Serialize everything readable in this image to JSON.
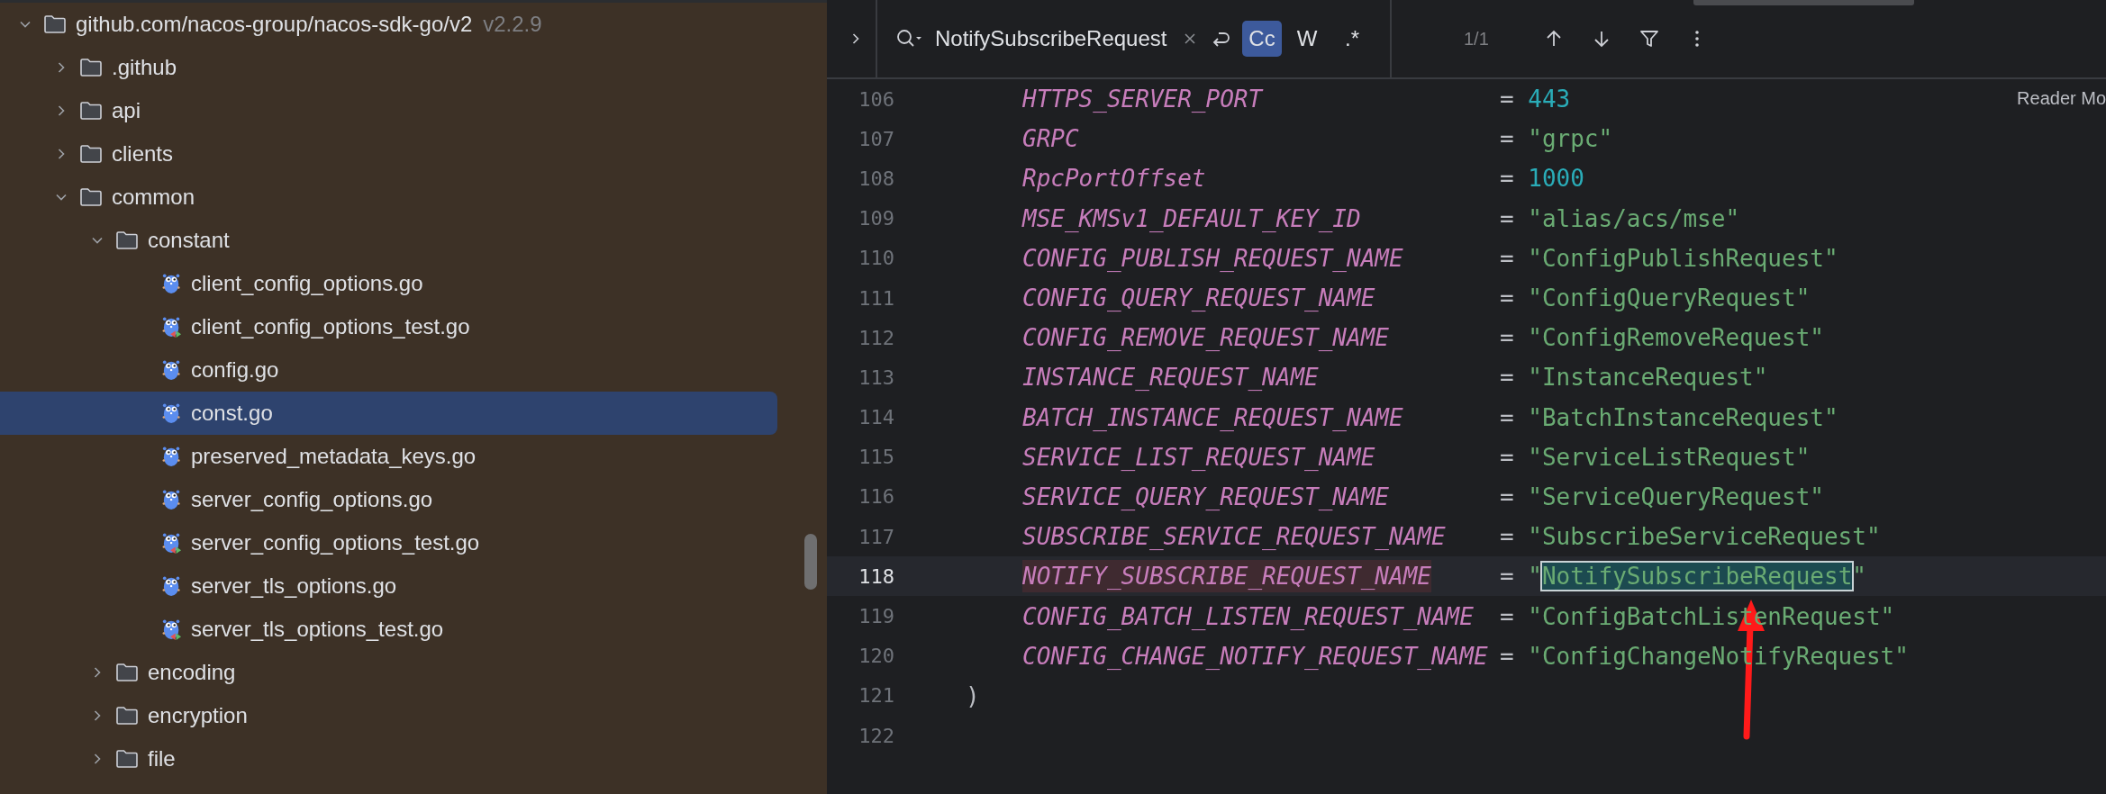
{
  "project_tree": {
    "items": [
      {
        "name": "github.com/nacos-group/nacos-sdk-go/v2",
        "version": "v2.2.9",
        "kind": "folder",
        "expanded": true,
        "selected": false,
        "children": [
          {
            "name": ".github",
            "kind": "folder",
            "expanded": false,
            "selected": false
          },
          {
            "name": "api",
            "kind": "folder",
            "expanded": false,
            "selected": false
          },
          {
            "name": "clients",
            "kind": "folder",
            "expanded": false,
            "selected": false
          },
          {
            "name": "common",
            "kind": "folder",
            "expanded": true,
            "selected": false,
            "children": [
              {
                "name": "constant",
                "kind": "folder",
                "expanded": true,
                "selected": false,
                "children": [
                  {
                    "name": "client_config_options.go",
                    "kind": "file",
                    "selected": false
                  },
                  {
                    "name": "client_config_options_test.go",
                    "kind": "test",
                    "selected": false
                  },
                  {
                    "name": "config.go",
                    "kind": "file",
                    "selected": false
                  },
                  {
                    "name": "const.go",
                    "kind": "file",
                    "selected": true
                  },
                  {
                    "name": "preserved_metadata_keys.go",
                    "kind": "file",
                    "selected": false
                  },
                  {
                    "name": "server_config_options.go",
                    "kind": "file",
                    "selected": false
                  },
                  {
                    "name": "server_config_options_test.go",
                    "kind": "test",
                    "selected": false
                  },
                  {
                    "name": "server_tls_options.go",
                    "kind": "file",
                    "selected": false
                  },
                  {
                    "name": "server_tls_options_test.go",
                    "kind": "test",
                    "selected": false
                  }
                ]
              },
              {
                "name": "encoding",
                "kind": "folder",
                "expanded": false,
                "selected": false
              },
              {
                "name": "encryption",
                "kind": "folder",
                "expanded": false,
                "selected": false
              },
              {
                "name": "file",
                "kind": "folder",
                "expanded": false,
                "selected": false
              }
            ]
          }
        ]
      }
    ]
  },
  "search_bar": {
    "query": "NotifySubscribeRequest",
    "options": [
      {
        "label": "Cc",
        "selected": true
      },
      {
        "label": "W",
        "selected": false
      },
      {
        "label": ".*",
        "selected": false
      }
    ],
    "result_count": "1/1"
  },
  "reader_mode": "Reader Mo",
  "code_lines": [
    {
      "number": "106",
      "kind": "number",
      "name": "HTTPS_SERVER_PORT",
      "equals": "=",
      "value": "443",
      "current": false,
      "match": false
    },
    {
      "number": "107",
      "kind": "string",
      "name": "GRPC",
      "equals": "=",
      "value": "\"grpc\"",
      "current": false,
      "match": false
    },
    {
      "number": "108",
      "kind": "number",
      "name": "RpcPortOffset",
      "equals": "=",
      "value": "1000",
      "current": false,
      "match": false
    },
    {
      "number": "109",
      "kind": "string",
      "name": "MSE_KMSv1_DEFAULT_KEY_ID",
      "equals": "=",
      "value": "\"alias/acs/mse\"",
      "current": false,
      "match": false
    },
    {
      "number": "110",
      "kind": "string",
      "name": "CONFIG_PUBLISH_REQUEST_NAME",
      "equals": "=",
      "value": "\"ConfigPublishRequest\"",
      "current": false,
      "match": false
    },
    {
      "number": "111",
      "kind": "string",
      "name": "CONFIG_QUERY_REQUEST_NAME",
      "equals": "=",
      "value": "\"ConfigQueryRequest\"",
      "current": false,
      "match": false
    },
    {
      "number": "112",
      "kind": "string",
      "name": "CONFIG_REMOVE_REQUEST_NAME",
      "equals": "=",
      "value": "\"ConfigRemoveRequest\"",
      "current": false,
      "match": false
    },
    {
      "number": "113",
      "kind": "string",
      "name": "INSTANCE_REQUEST_NAME",
      "equals": "=",
      "value": "\"InstanceRequest\"",
      "current": false,
      "match": false
    },
    {
      "number": "114",
      "kind": "string",
      "name": "BATCH_INSTANCE_REQUEST_NAME",
      "equals": "=",
      "value": "\"BatchInstanceRequest\"",
      "current": false,
      "match": false
    },
    {
      "number": "115",
      "kind": "string",
      "name": "SERVICE_LIST_REQUEST_NAME",
      "equals": "=",
      "value": "\"ServiceListRequest\"",
      "current": false,
      "match": false
    },
    {
      "number": "116",
      "kind": "string",
      "name": "SERVICE_QUERY_REQUEST_NAME",
      "equals": "=",
      "value": "\"ServiceQueryRequest\"",
      "current": false,
      "match": false
    },
    {
      "number": "117",
      "kind": "string",
      "name": "SUBSCRIBE_SERVICE_REQUEST_NAME",
      "equals": "=",
      "value": "\"SubscribeServiceRequest\"",
      "current": false,
      "match": false
    },
    {
      "number": "118",
      "kind": "string",
      "name": "NOTIFY_SUBSCRIBE_REQUEST_NAME",
      "equals": "=",
      "value": "\"NotifySubscribeRequest\"",
      "current": true,
      "match": true
    },
    {
      "number": "119",
      "kind": "string",
      "name": "CONFIG_BATCH_LISTEN_REQUEST_NAME",
      "equals": "=",
      "value": "\"ConfigBatchListenRequest\"",
      "current": false,
      "match": false
    },
    {
      "number": "120",
      "kind": "string",
      "name": "CONFIG_CHANGE_NOTIFY_REQUEST_NAME",
      "equals": "=",
      "value": "\"ConfigChangeNotifyRequest\"",
      "current": false,
      "match": false
    },
    {
      "number": "121",
      "kind": "close",
      "text": ")",
      "current": false
    },
    {
      "number": "122",
      "kind": "empty",
      "current": false
    }
  ]
}
